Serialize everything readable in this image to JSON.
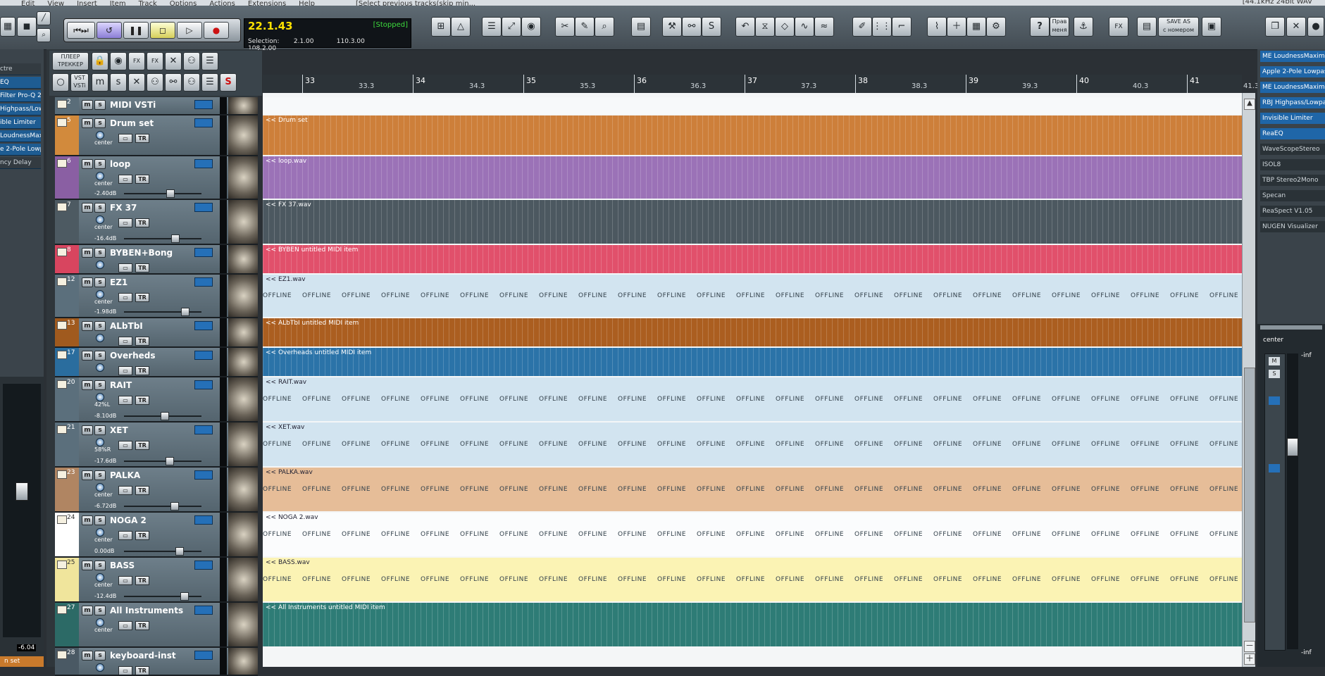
{
  "menu": [
    "Edit",
    "View",
    "Insert",
    "Item",
    "Track",
    "Options",
    "Actions",
    "Extensions",
    "Help"
  ],
  "window_title": "[Select previous tracks(skip min...",
  "window_status": "[44.1kHz 24bit WAV",
  "transport": {
    "time": "22.1.43",
    "state": "[Stopped]",
    "selection_label": "Selection:",
    "sel_start": "2.1.00",
    "sel_end": "110.3.00",
    "sel_length": "108.2.00"
  },
  "toolbar": {
    "tracker_label_1": "ПЛЕЕР",
    "tracker_label_2": "ТРЕККЕР",
    "vst_label_1": "VST",
    "vst_label_2": "VSTi",
    "help_label": "?",
    "edit_label_1": "Прав",
    "edit_label_2": "меня",
    "save_as_1": "SAVE AS",
    "save_as_2": "с номером",
    "fx_label": "FX"
  },
  "left_fx_slots": [
    "ctre",
    "EQ",
    "Filter Pro-Q 2",
    "Highpass/Low",
    "ible Limiter",
    "LoudnessMaxi",
    "e 2-Pole Lowp",
    "ncy Delay"
  ],
  "left_meter_value": "-6.04",
  "left_track_label": "n set",
  "ruler": {
    "major": [
      "33",
      "34",
      "35",
      "36",
      "37",
      "38",
      "39",
      "40",
      "41"
    ],
    "minor": [
      "33.3",
      "34.3",
      "35.3",
      "36.3",
      "37.3",
      "38.3",
      "39.3",
      "40.3",
      "41.3"
    ]
  },
  "tracks": [
    {
      "num": "2",
      "name": "MIDI VSTi",
      "color": "#5a6d79",
      "pan": "",
      "vol": "",
      "item": "",
      "offline": false,
      "lane": "#f7f9fa"
    },
    {
      "num": "5",
      "name": "Drum set",
      "color": "#d28a3c",
      "pan": "center",
      "vol": "",
      "item": "<< Drum set",
      "offline": false,
      "lane": "#cd7f3a"
    },
    {
      "num": "6",
      "name": "loop",
      "color": "#8a5fa3",
      "pan": "center",
      "vol": "-2.40dB",
      "item": "<< loop.wav",
      "offline": false,
      "lane": "#9b72b7"
    },
    {
      "num": "7",
      "name": "FX 37",
      "color": "#4d5a62",
      "pan": "center",
      "vol": "-16.4dB",
      "item": "<< FX 37.wav",
      "offline": false,
      "lane": "#4c5860"
    },
    {
      "num": "8",
      "name": "BYBEN+Bong",
      "color": "#d8455f",
      "pan": "",
      "vol": "",
      "item": "<< BYBEN untitled MIDI item",
      "offline": false,
      "lane": "#e1506b"
    },
    {
      "num": "12",
      "name": "EZ1",
      "color": "#5b6f7c",
      "pan": "center",
      "vol": "-1.98dB",
      "item": "<< EZ1.wav",
      "offline": true,
      "lane": "#d2e4f0"
    },
    {
      "num": "13",
      "name": "ALbTbI",
      "color": "#a05a1e",
      "pan": "",
      "vol": "",
      "item": "<< ALbTbI untitled MIDI item",
      "offline": false,
      "lane": "#ab5e20"
    },
    {
      "num": "17",
      "name": "Overheds",
      "color": "#2a6d9e",
      "pan": "",
      "vol": "",
      "item": "<< Overheads untitled MIDI item",
      "offline": false,
      "lane": "#2b73a8"
    },
    {
      "num": "20",
      "name": "RAIT",
      "color": "#5b6f7c",
      "pan": "42%L",
      "vol": "-8.10dB",
      "item": "<< RAIT.wav",
      "offline": true,
      "lane": "#d2e4f0"
    },
    {
      "num": "21",
      "name": "XET",
      "color": "#5b6f7c",
      "pan": "58%R",
      "vol": "-17.6dB",
      "item": "<< XET.wav",
      "offline": true,
      "lane": "#d2e4f0"
    },
    {
      "num": "23",
      "name": "PALKA",
      "color": "#b08562",
      "pan": "center",
      "vol": "-6.72dB",
      "item": "<< PALKA.wav",
      "offline": true,
      "lane": "#e6bd98"
    },
    {
      "num": "24",
      "name": "NOGA 2",
      "color": "#ffffff",
      "pan": "center",
      "vol": "0.00dB",
      "item": "<< NOGA 2.wav",
      "offline": true,
      "lane": "#fbfcfd"
    },
    {
      "num": "25",
      "name": "BASS",
      "color": "#f0e59c",
      "pan": "center",
      "vol": "-12.4dB",
      "item": "<< BASS.wav",
      "offline": true,
      "lane": "#fbf3b4"
    },
    {
      "num": "27",
      "name": "All Instruments",
      "color": "#2c6a66",
      "pan": "center",
      "vol": "",
      "item": "<< All Instruments untitled MIDI item",
      "offline": false,
      "lane": "#2e7c76"
    },
    {
      "num": "28",
      "name": "keyboard-inst",
      "color": "#4a5964",
      "pan": "",
      "vol": "",
      "item": "",
      "offline": false,
      "lane": "#f4f6f7"
    }
  ],
  "offline_text": "OFFLINE",
  "right_fx_slots": [
    {
      "label": "ME LoudnessMaxim",
      "active": true
    },
    {
      "label": "Apple 2-Pole Lowpass",
      "active": true
    },
    {
      "label": "ME LoudnessMaxim",
      "active": true
    },
    {
      "label": "RBJ Highpass/Lowpas",
      "active": true
    },
    {
      "label": "Invisible Limiter",
      "active": true
    },
    {
      "label": "ReaEQ",
      "active": true
    },
    {
      "label": "WaveScopeStereo",
      "active": false
    },
    {
      "label": "ISOL8",
      "active": false
    },
    {
      "label": "TBP Stereo2Mono",
      "active": false
    },
    {
      "label": "Specan",
      "active": false
    },
    {
      "label": "ReaSpect V1.05",
      "active": false
    },
    {
      "label": "NUGEN Visualizer",
      "active": false
    }
  ],
  "right_mixer": {
    "pan": "center",
    "inf": "-inf",
    "db": "-inf"
  },
  "colors": {
    "accent_blue": "#1e5c92",
    "time_yellow": "#ffe100",
    "stopped_green": "#3ddc3d"
  }
}
